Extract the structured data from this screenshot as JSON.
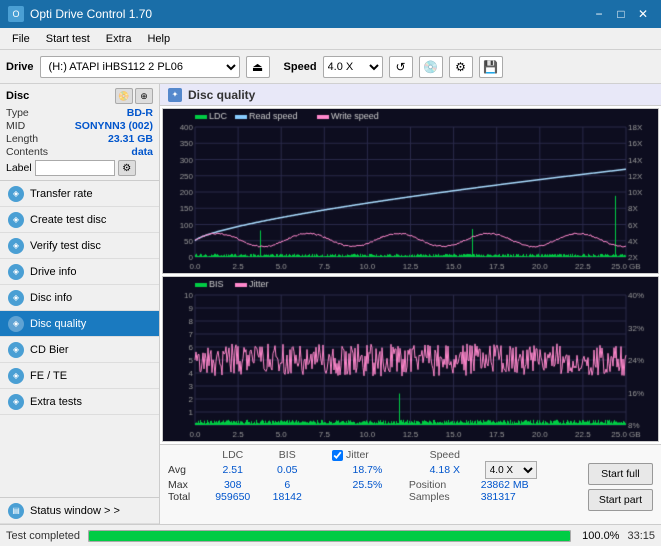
{
  "titlebar": {
    "title": "Opti Drive Control 1.70",
    "icon": "O",
    "minimize": "−",
    "maximize": "□",
    "close": "✕"
  },
  "menu": {
    "items": [
      "File",
      "Start test",
      "Extra",
      "Help"
    ]
  },
  "drivebar": {
    "label": "Drive",
    "drive_value": "(H:) ATAPI iHBS112 2 PL06",
    "speed_label": "Speed",
    "speed_value": "4.0 X"
  },
  "disc": {
    "title": "Disc",
    "type_label": "Type",
    "type_value": "BD-R",
    "mid_label": "MID",
    "mid_value": "SONYNN3 (002)",
    "length_label": "Length",
    "length_value": "23.31 GB",
    "contents_label": "Contents",
    "contents_value": "data",
    "label_label": "Label",
    "label_value": ""
  },
  "sidebar": {
    "items": [
      {
        "id": "transfer-rate",
        "label": "Transfer rate",
        "active": false
      },
      {
        "id": "create-test-disc",
        "label": "Create test disc",
        "active": false
      },
      {
        "id": "verify-test-disc",
        "label": "Verify test disc",
        "active": false
      },
      {
        "id": "drive-info",
        "label": "Drive info",
        "active": false
      },
      {
        "id": "disc-info",
        "label": "Disc info",
        "active": false
      },
      {
        "id": "disc-quality",
        "label": "Disc quality",
        "active": true
      },
      {
        "id": "cd-bier",
        "label": "CD Bier",
        "active": false
      },
      {
        "id": "fe-te",
        "label": "FE / TE",
        "active": false
      },
      {
        "id": "extra-tests",
        "label": "Extra tests",
        "active": false
      }
    ],
    "status_window": "Status window > >"
  },
  "disc_quality": {
    "title": "Disc quality",
    "chart1": {
      "legend": [
        {
          "label": "LDC",
          "color": "#00cc44"
        },
        {
          "label": "Read speed",
          "color": "#88ccff"
        },
        {
          "label": "Write speed",
          "color": "#ff88cc"
        }
      ],
      "y_left": [
        "400",
        "350",
        "300",
        "250",
        "200",
        "150",
        "100",
        "50",
        "0"
      ],
      "y_right": [
        "18X",
        "16X",
        "14X",
        "12X",
        "10X",
        "8X",
        "6X",
        "4X",
        "2X"
      ],
      "x_labels": [
        "0.0",
        "2.5",
        "5.0",
        "7.5",
        "10.0",
        "12.5",
        "15.0",
        "17.5",
        "20.0",
        "22.5",
        "25.0 GB"
      ]
    },
    "chart2": {
      "legend": [
        {
          "label": "BIS",
          "color": "#00cc44"
        },
        {
          "label": "Jitter",
          "color": "#ff88cc"
        }
      ],
      "y_left": [
        "10",
        "9",
        "8",
        "7",
        "6",
        "5",
        "4",
        "3",
        "2",
        "1"
      ],
      "y_right": [
        "40%",
        "32%",
        "24%",
        "16%",
        "8%"
      ],
      "x_labels": [
        "0.0",
        "2.5",
        "5.0",
        "7.5",
        "10.0",
        "12.5",
        "15.0",
        "17.5",
        "20.0",
        "22.5",
        "25.0 GB"
      ]
    }
  },
  "stats": {
    "headers": [
      "LDC",
      "BIS",
      "",
      "Jitter",
      "Speed",
      "",
      ""
    ],
    "avg_label": "Avg",
    "avg_ldc": "2.51",
    "avg_bis": "0.05",
    "avg_jitter": "18.7%",
    "max_label": "Max",
    "max_ldc": "308",
    "max_bis": "6",
    "max_jitter": "25.5%",
    "total_label": "Total",
    "total_ldc": "959650",
    "total_bis": "18142",
    "speed_label": "Speed",
    "speed_value": "4.18 X",
    "speed_select": "4.0 X",
    "position_label": "Position",
    "position_value": "23862 MB",
    "samples_label": "Samples",
    "samples_value": "381317",
    "start_full": "Start full",
    "start_part": "Start part",
    "jitter_checked": true,
    "jitter_label": "Jitter"
  },
  "statusbar": {
    "text": "Test completed",
    "progress": 100,
    "progress_text": "100.0%",
    "time": "33:15"
  }
}
